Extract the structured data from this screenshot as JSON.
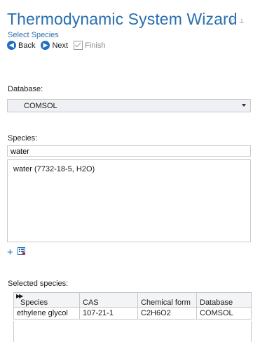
{
  "window": {
    "title": "Thermodynamic System Wizard",
    "subtitle": "Select Species",
    "controls": [
      "⌄",
      "□",
      "⊥"
    ]
  },
  "toolbar": {
    "back_label": "Back",
    "next_label": "Next",
    "finish_label": "Finish"
  },
  "database": {
    "label": "Database:",
    "selected": "COMSOL"
  },
  "species": {
    "label": "Species:",
    "search_value": "water",
    "results": [
      "water (7732-18-5, H2O)"
    ]
  },
  "selected_species": {
    "label": "Selected species:",
    "columns": [
      "Species",
      "CAS",
      "Chemical form",
      "Database"
    ],
    "rows": [
      [
        "ethylene glycol",
        "107-21-1",
        "C2H6O2",
        "COMSOL"
      ]
    ]
  },
  "colors": {
    "accent": "#2a6fb0",
    "button_icon": "#1f6fc4",
    "border": "#c9c9c9"
  },
  "icons": {
    "back": "arrow-left-circle-icon",
    "next": "arrow-right-circle-icon",
    "finish": "checkbox-check-icon",
    "add": "plus-icon",
    "browse": "browse-list-icon"
  }
}
